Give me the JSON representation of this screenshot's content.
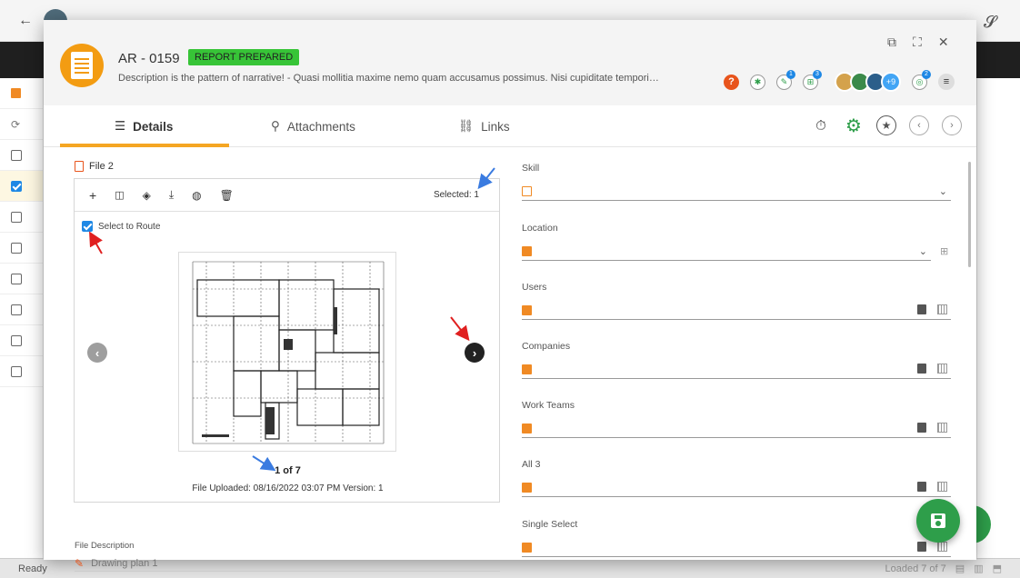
{
  "record": {
    "id": "AR - 0159",
    "status": "REPORT PREPARED",
    "description": "Description is the pattern of narrative!  - Quasi mollitia maxime nemo quam accusamus possimus. Nisi cupiditate temporibus iu..."
  },
  "header": {
    "avatars_more": "+9",
    "badges": [
      "1",
      "3",
      "2"
    ]
  },
  "tabs": [
    {
      "label": "Details"
    },
    {
      "label": "Attachments"
    },
    {
      "label": "Links"
    }
  ],
  "file": {
    "title": "File 2",
    "selected": "Selected: 1",
    "select_to_route": "Select to Route",
    "pager": "1 of 7",
    "uploaded": "File Uploaded: 08/16/2022 03:07 PM  Version: 1",
    "description_label": "File Description",
    "description_value": "Drawing plan 1"
  },
  "form": {
    "fields": [
      {
        "label": "Skill"
      },
      {
        "label": "Location"
      },
      {
        "label": "Users"
      },
      {
        "label": "Companies"
      },
      {
        "label": "Work Teams"
      },
      {
        "label": "All 3"
      },
      {
        "label": "Single Select"
      }
    ]
  },
  "status_bar": {
    "left": "Ready",
    "right": "Loaded 7 of 7"
  },
  "colors": {
    "accent": "#f5a623",
    "status_green": "#37c437",
    "fab_green": "#2e9e4a",
    "icon_orange": "#f08a24"
  }
}
